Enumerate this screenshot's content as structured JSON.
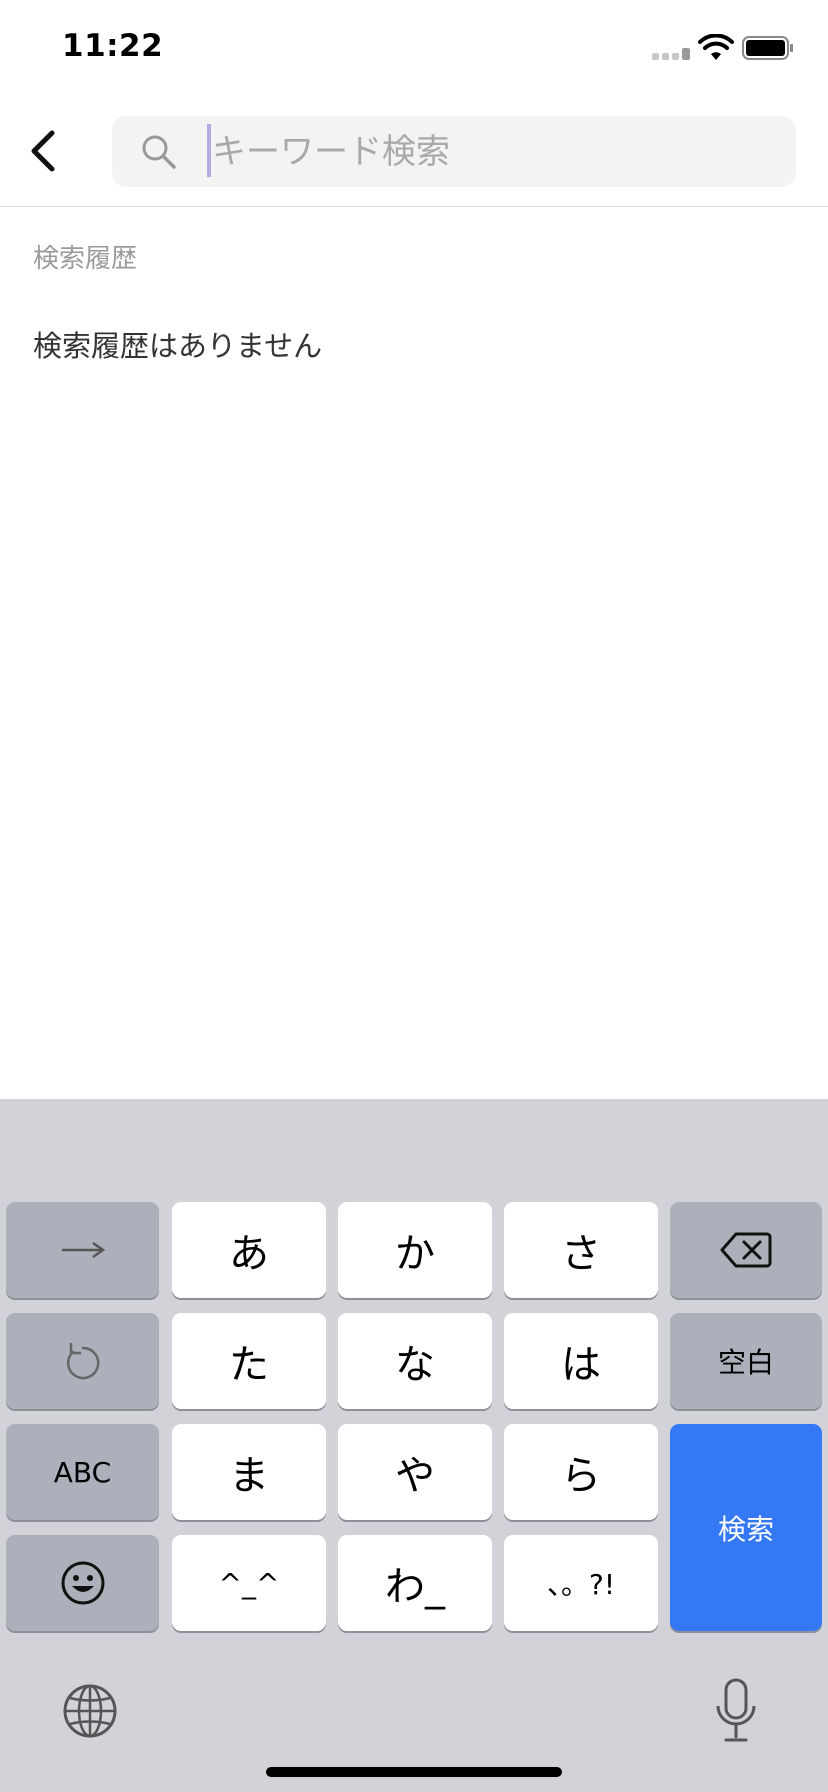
{
  "status_bar": {
    "time": "11:22"
  },
  "header": {
    "search": {
      "placeholder": "キーワード検索",
      "value": ""
    }
  },
  "history": {
    "title": "検索履歴",
    "empty_message": "検索履歴はありません"
  },
  "keyboard": {
    "rows": [
      [
        "→",
        "あ",
        "か",
        "さ",
        "⌫"
      ],
      [
        "↺",
        "た",
        "な",
        "は",
        "空白"
      ],
      [
        "ABC",
        "ま",
        "や",
        "ら",
        "検索"
      ],
      [
        "☺",
        "^_^",
        "わ_",
        "、。?!"
      ]
    ],
    "keys": {
      "next": "→",
      "a": "あ",
      "ka": "か",
      "sa": "さ",
      "undo": "↺",
      "ta": "た",
      "na": "な",
      "ha": "は",
      "space": "空白",
      "abc": "ABC",
      "ma": "ま",
      "ya": "や",
      "ra": "ら",
      "search": "検索",
      "emoticon": "^_^",
      "wa": "わ_",
      "punct": "、。?!"
    },
    "accent_color": "#3478f6"
  }
}
